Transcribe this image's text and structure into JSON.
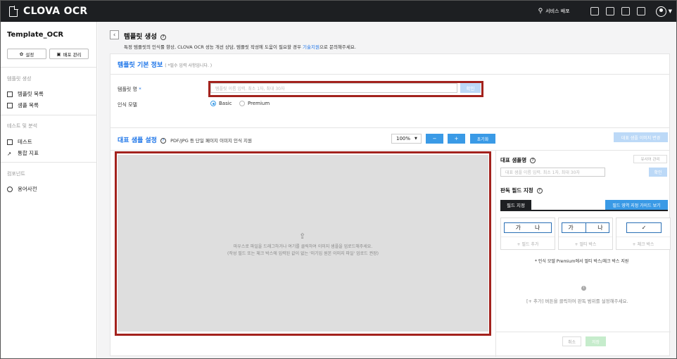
{
  "app": {
    "name": "CLOVA OCR"
  },
  "topbar": {
    "deploy_label": "서비스 배포",
    "avatar_badge": "ck"
  },
  "sidebar": {
    "project_title": "Template_OCR",
    "settings_label": "설정",
    "deploy_manage_label": "배포 관리",
    "categories": [
      {
        "label": "템플릿 생성",
        "items": [
          "템플릿 목록",
          "샘플 목록"
        ]
      },
      {
        "label": "테스트 및 분석",
        "items": [
          "테스트",
          "통합 지표"
        ]
      },
      {
        "label": "컴포넌트",
        "items": [
          "용어사전"
        ]
      }
    ]
  },
  "page": {
    "title": "템플릿 생성",
    "desc_prefix": "특정 템플릿의 인식률 향상, CLOVA OCR 성능 개선 상담, 템플릿 작성에 도움이 필요할 경우 ",
    "desc_link": "기술지원",
    "desc_suffix": "으로 문의해주세요."
  },
  "basic_info": {
    "title": "템플릿 기본 정보",
    "note": "( *필수 입력 사항입니다. )",
    "name_label": "템플릿 명",
    "name_required": "*",
    "name_placeholder": "템플릿 이름 입력. 최소 1자, 최대 30자",
    "confirm_label": "확인",
    "model_label": "인식 모델",
    "model_options": [
      "Basic",
      "Premium"
    ],
    "model_selected": "Basic"
  },
  "sample": {
    "title": "대표 샘플 설정",
    "subtitle": "PDF/JPG 등 단일 페이지 이미지 인식 지원",
    "zoom": "100%",
    "zoom_out": "−",
    "zoom_in": "+",
    "reset_label": "초기화",
    "change_image_label": "대표 샘플 이미지 변경",
    "upload_line1": "마우스로 파일을 드래그하거나 여기를 클릭하여 이미지 샘플을 업로드해주세요.",
    "upload_line2": "(작성 필드 또는 체크 박스에 입력된 값이 없는 '미기입 원본 이미지 파일' 업로드 권장)"
  },
  "right_panel": {
    "sample_name_title": "대표 샘플명",
    "word_manage_label": "유사어 관리",
    "sample_name_placeholder": "대표 샘플 이름 입력. 최소 1자, 최대 30자",
    "confirm_label": "확인",
    "field_title": "판독 필드 지정",
    "tab_label": "필드 지정",
    "guide_label": "필드 영역 지정 가이드 보기",
    "field_cards": [
      {
        "preview": [
          "가",
          "나"
        ],
        "split": false,
        "action": "+ 필드 추가"
      },
      {
        "preview": [
          "가",
          "나"
        ],
        "split": true,
        "action": "+ 멀티 박스"
      },
      {
        "preview": [
          "✓"
        ],
        "split": false,
        "action": "+ 체크 박스"
      }
    ],
    "premium_note": "* 인식 모델 Premium에서 멀티 박스/체크 박스 지원",
    "empty_icon": "i",
    "empty_text": "[+ 추가] 버튼을 클릭하여 판독 범위를 설정해주세요.",
    "cancel_label": "취소",
    "save_label": "저장"
  }
}
